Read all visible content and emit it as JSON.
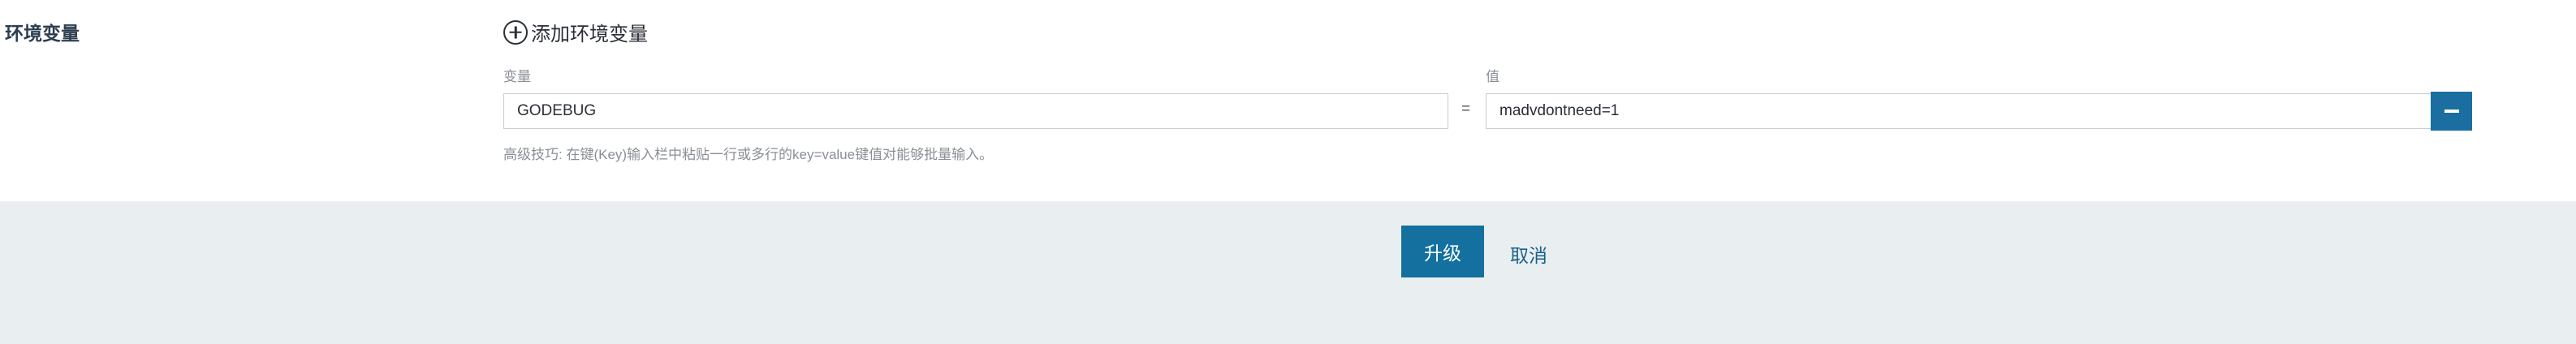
{
  "section": {
    "title": "环境变量",
    "add_label": "添加环境变量"
  },
  "env": {
    "key_header": "变量",
    "value_header": "值",
    "separator": "=",
    "rows": [
      {
        "key": "GODEBUG",
        "value": "madvdontneed=1"
      }
    ],
    "hint": "高级技巧: 在键(Key)输入栏中粘贴一行或多行的key=value键值对能够批量输入。"
  },
  "footer": {
    "upgrade_label": "升级",
    "cancel_label": "取消"
  },
  "icons": {
    "add": "plus-circle-icon",
    "remove": "minus-icon"
  },
  "colors": {
    "primary": "#13709f",
    "footer_bg": "#e9eff0",
    "link": "#1a5f8c"
  }
}
